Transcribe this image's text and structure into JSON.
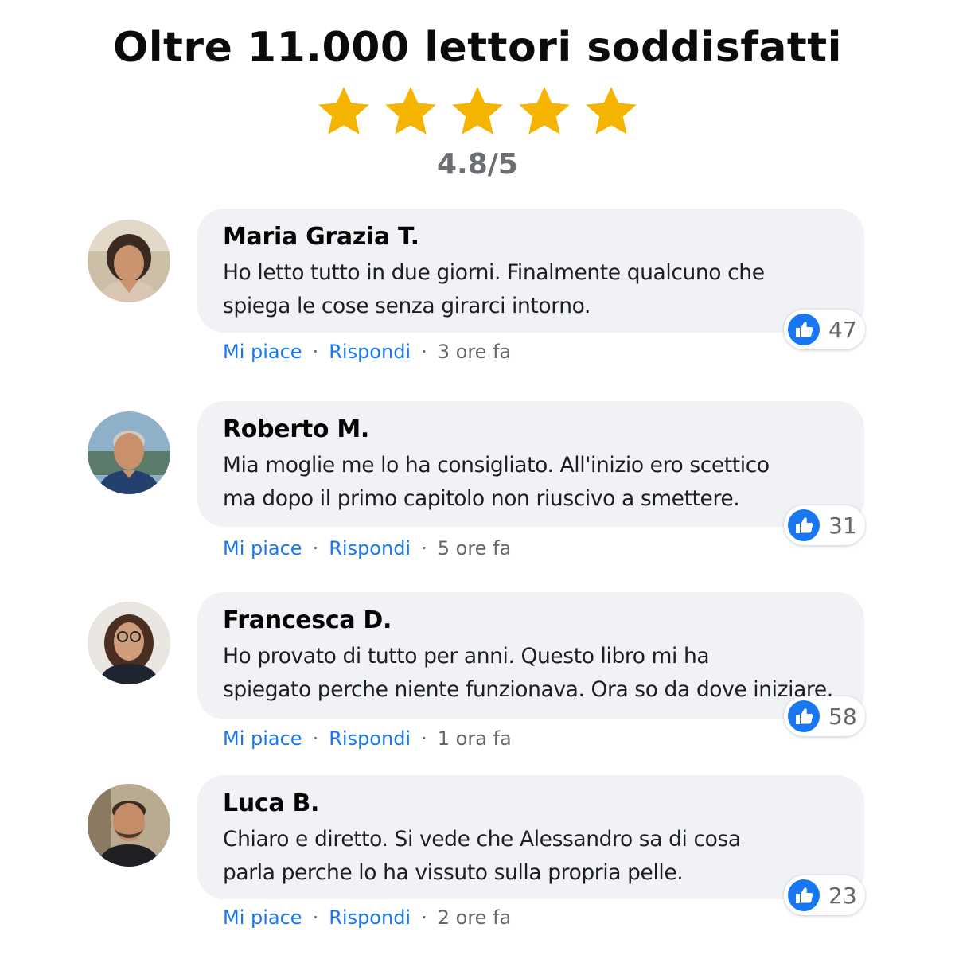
{
  "header": {
    "title": "Oltre 11.000 lettori soddisfatti",
    "stars": 5,
    "star_color": "#f5b400",
    "rating": "4.8/5"
  },
  "actions": {
    "like_label": "Mi piace",
    "reply_label": "Rispondi",
    "separator": "·",
    "link_color": "#1877f2",
    "meta_color": "#65676b"
  },
  "comments": [
    {
      "author": "Maria Grazia T.",
      "text": "Ho letto tutto in due giorni. Finalmente qualcuno che\nspiega le cose senza girarci intorno.",
      "likes": "47",
      "time": "3 ore fa"
    },
    {
      "author": "Roberto M.",
      "text": "Mia moglie me lo ha consigliato. All'inizio ero scettico\nma dopo il primo capitolo non riuscivo a smettere.",
      "likes": "31",
      "time": "5 ore fa"
    },
    {
      "author": "Francesca D.",
      "text": "Ho provato di tutto per anni. Questo libro mi ha\nspiegato perche niente funzionava. Ora so da dove iniziare.",
      "likes": "58",
      "time": "1 ora fa"
    },
    {
      "author": "Luca B.",
      "text": "Chiaro e diretto. Si vede che Alessandro sa di cosa\nparla perche lo ha vissuto sulla propria pelle.",
      "likes": "23",
      "time": "2 ore fa"
    }
  ]
}
